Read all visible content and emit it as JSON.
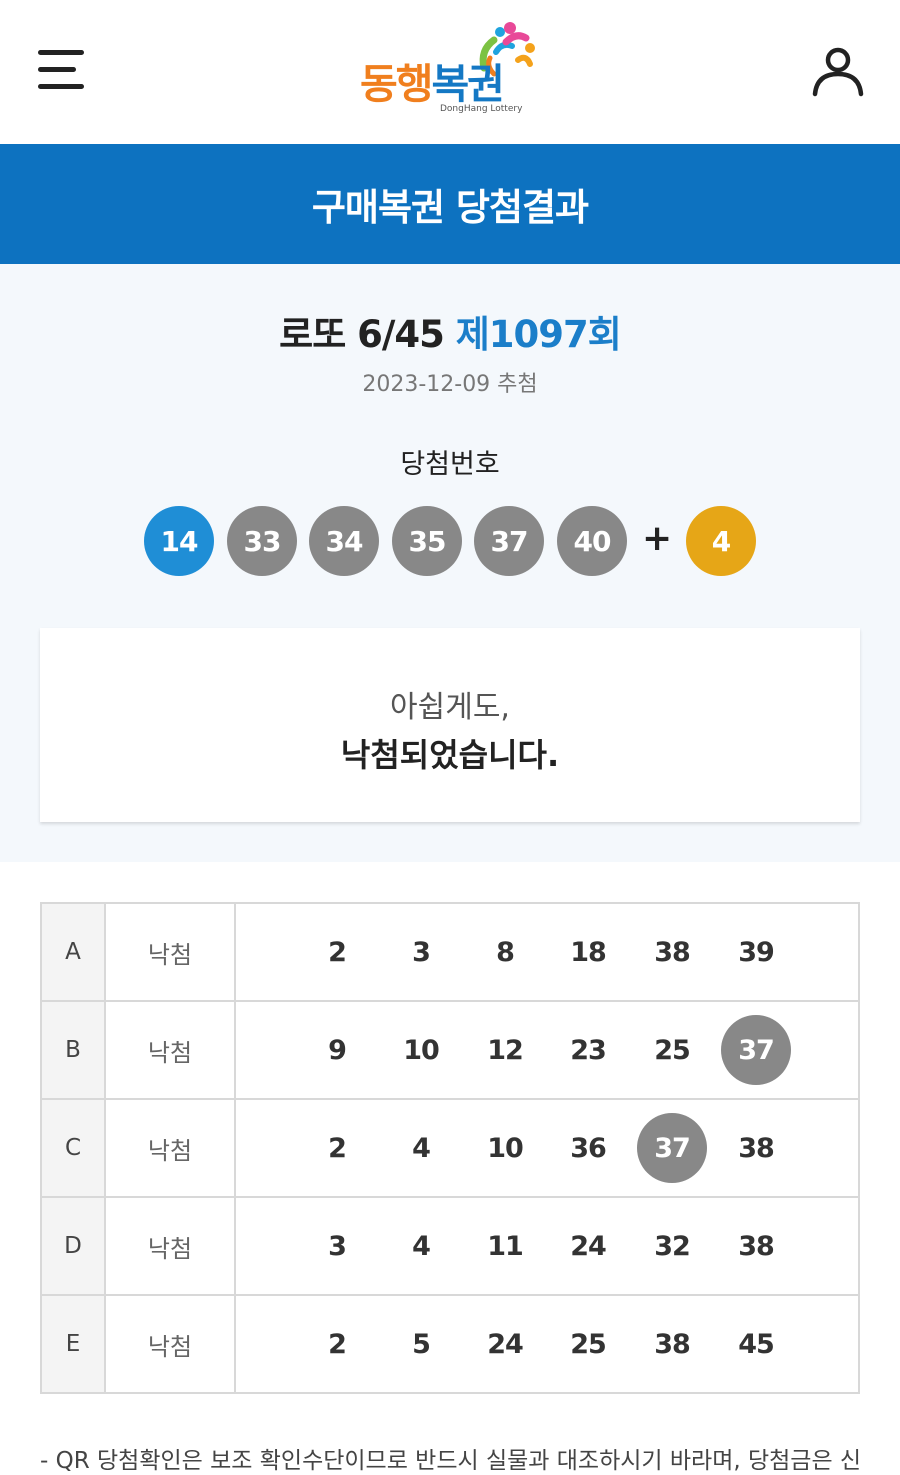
{
  "header": {
    "logo_text": "동행복권",
    "logo_subtext": "DongHang Lottery",
    "icons": {
      "menu": "hamburger-menu-icon",
      "user": "user-icon"
    }
  },
  "titlebar": {
    "title": "구매복권 당첨결과"
  },
  "draw": {
    "game": "로또 6/45",
    "round": "제1097회",
    "date": "2023-12-09 추첨",
    "winning_label": "당첨번호",
    "winning_numbers": [
      "14",
      "33",
      "34",
      "35",
      "37",
      "40"
    ],
    "plus": "+",
    "bonus": "4"
  },
  "message": {
    "line1": "아쉽게도,",
    "line2": "낙첨되었습니다."
  },
  "tickets": [
    {
      "slot": "A",
      "status": "낙첨",
      "numbers": [
        "2",
        "3",
        "8",
        "18",
        "38",
        "39"
      ],
      "hits": []
    },
    {
      "slot": "B",
      "status": "낙첨",
      "numbers": [
        "9",
        "10",
        "12",
        "23",
        "25",
        "37"
      ],
      "hits": [
        5
      ]
    },
    {
      "slot": "C",
      "status": "낙첨",
      "numbers": [
        "2",
        "4",
        "10",
        "36",
        "37",
        "38"
      ],
      "hits": [
        4
      ]
    },
    {
      "slot": "D",
      "status": "낙첨",
      "numbers": [
        "3",
        "4",
        "11",
        "24",
        "32",
        "38"
      ],
      "hits": []
    },
    {
      "slot": "E",
      "status": "낙첨",
      "numbers": [
        "2",
        "5",
        "24",
        "25",
        "38",
        "45"
      ],
      "hits": []
    }
  ],
  "notice": "- QR 당첨확인은 보조 확인수단이므로 반드시 실물과 대조하시기 바라며, 당첨금은 신",
  "colors": {
    "primary": "#0d72c0",
    "round_blue": "#1b7ec9",
    "ball_blue": "#1f8ed6",
    "ball_gray": "#888888",
    "ball_yellow": "#e6a617",
    "hit_gray": "#888888",
    "logo_orange": "#f07f1e",
    "logo_blue": "#1478c4"
  }
}
